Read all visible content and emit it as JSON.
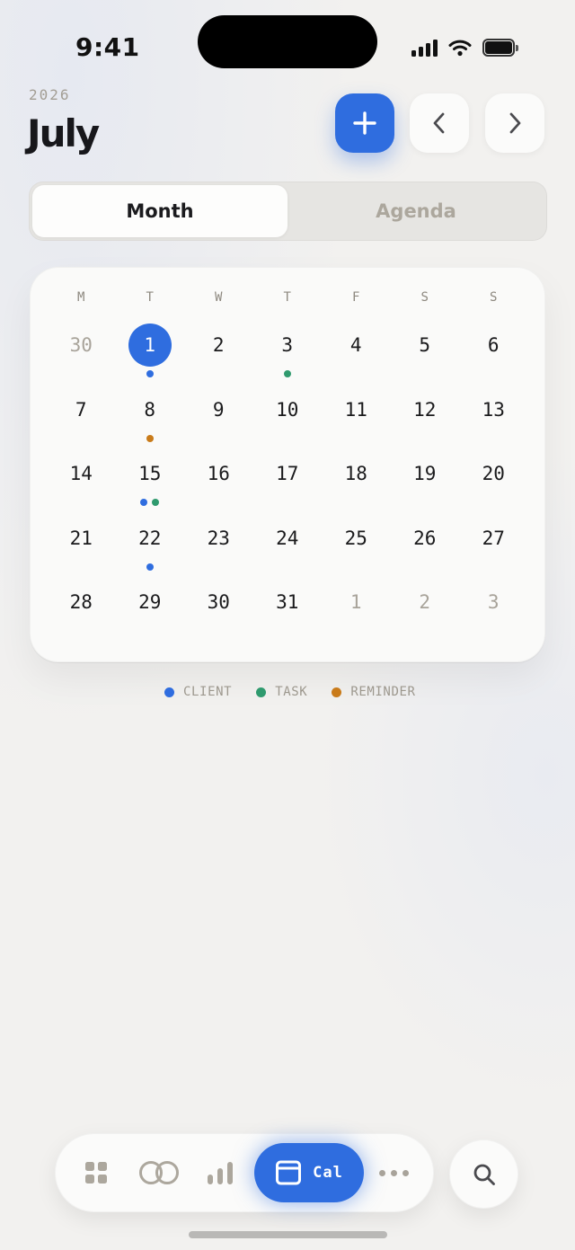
{
  "status_bar": {
    "time": "9:41",
    "icons": [
      "cellular-signal-icon",
      "wifi-icon",
      "battery-icon"
    ]
  },
  "header": {
    "year": "2026",
    "month": "July",
    "add_icon": "plus-icon",
    "prev_icon": "chevron-left-icon",
    "next_icon": "chevron-right-icon"
  },
  "view_toggle": {
    "options": [
      "Month",
      "Agenda"
    ],
    "selected": "Month"
  },
  "calendar": {
    "weekdays": [
      "M",
      "T",
      "W",
      "T",
      "F",
      "S",
      "S"
    ],
    "today": "1",
    "weeks": [
      [
        {
          "day": "30",
          "muted": true,
          "events": []
        },
        {
          "day": "1",
          "today": true,
          "events": [
            "client"
          ]
        },
        {
          "day": "2",
          "events": []
        },
        {
          "day": "3",
          "events": [
            "task"
          ]
        },
        {
          "day": "4",
          "events": []
        },
        {
          "day": "5",
          "events": []
        },
        {
          "day": "6",
          "events": []
        }
      ],
      [
        {
          "day": "7",
          "events": []
        },
        {
          "day": "8",
          "events": [
            "reminder"
          ]
        },
        {
          "day": "9",
          "events": []
        },
        {
          "day": "10",
          "events": []
        },
        {
          "day": "11",
          "events": []
        },
        {
          "day": "12",
          "events": []
        },
        {
          "day": "13",
          "events": []
        }
      ],
      [
        {
          "day": "14",
          "events": []
        },
        {
          "day": "15",
          "events": [
            "client",
            "task"
          ]
        },
        {
          "day": "16",
          "events": []
        },
        {
          "day": "17",
          "events": []
        },
        {
          "day": "18",
          "events": []
        },
        {
          "day": "19",
          "events": []
        },
        {
          "day": "20",
          "events": []
        }
      ],
      [
        {
          "day": "21",
          "events": []
        },
        {
          "day": "22",
          "events": [
            "client"
          ]
        },
        {
          "day": "23",
          "events": []
        },
        {
          "day": "24",
          "events": []
        },
        {
          "day": "25",
          "events": []
        },
        {
          "day": "26",
          "events": []
        },
        {
          "day": "27",
          "events": []
        }
      ],
      [
        {
          "day": "28",
          "events": []
        },
        {
          "day": "29",
          "events": []
        },
        {
          "day": "30",
          "events": []
        },
        {
          "day": "31",
          "events": []
        },
        {
          "day": "1",
          "muted": true,
          "events": []
        },
        {
          "day": "2",
          "muted": true,
          "events": []
        },
        {
          "day": "3",
          "muted": true,
          "events": []
        }
      ]
    ]
  },
  "legend": [
    {
      "key": "client",
      "label": "CLIENT",
      "color": "#2f6ddf"
    },
    {
      "key": "task",
      "label": "TASK",
      "color": "#2f9a6e"
    },
    {
      "key": "reminder",
      "label": "REMINDER",
      "color": "#c97b1a"
    }
  ],
  "colors": {
    "accent": "#2f6ddf",
    "client": "#2f6ddf",
    "task": "#2f9a6e",
    "reminder": "#c97b1a",
    "muted_text": "#a8a39a"
  },
  "tab_bar": {
    "items": [
      {
        "key": "dashboard",
        "icon": "grid-icon"
      },
      {
        "key": "clients",
        "icon": "rings-icon"
      },
      {
        "key": "stats",
        "icon": "bar-chart-icon"
      },
      {
        "key": "calendar",
        "icon": "calendar-icon",
        "label": "Cal",
        "active": true
      },
      {
        "key": "more",
        "icon": "more-dots-icon"
      }
    ],
    "search_icon": "search-icon"
  }
}
